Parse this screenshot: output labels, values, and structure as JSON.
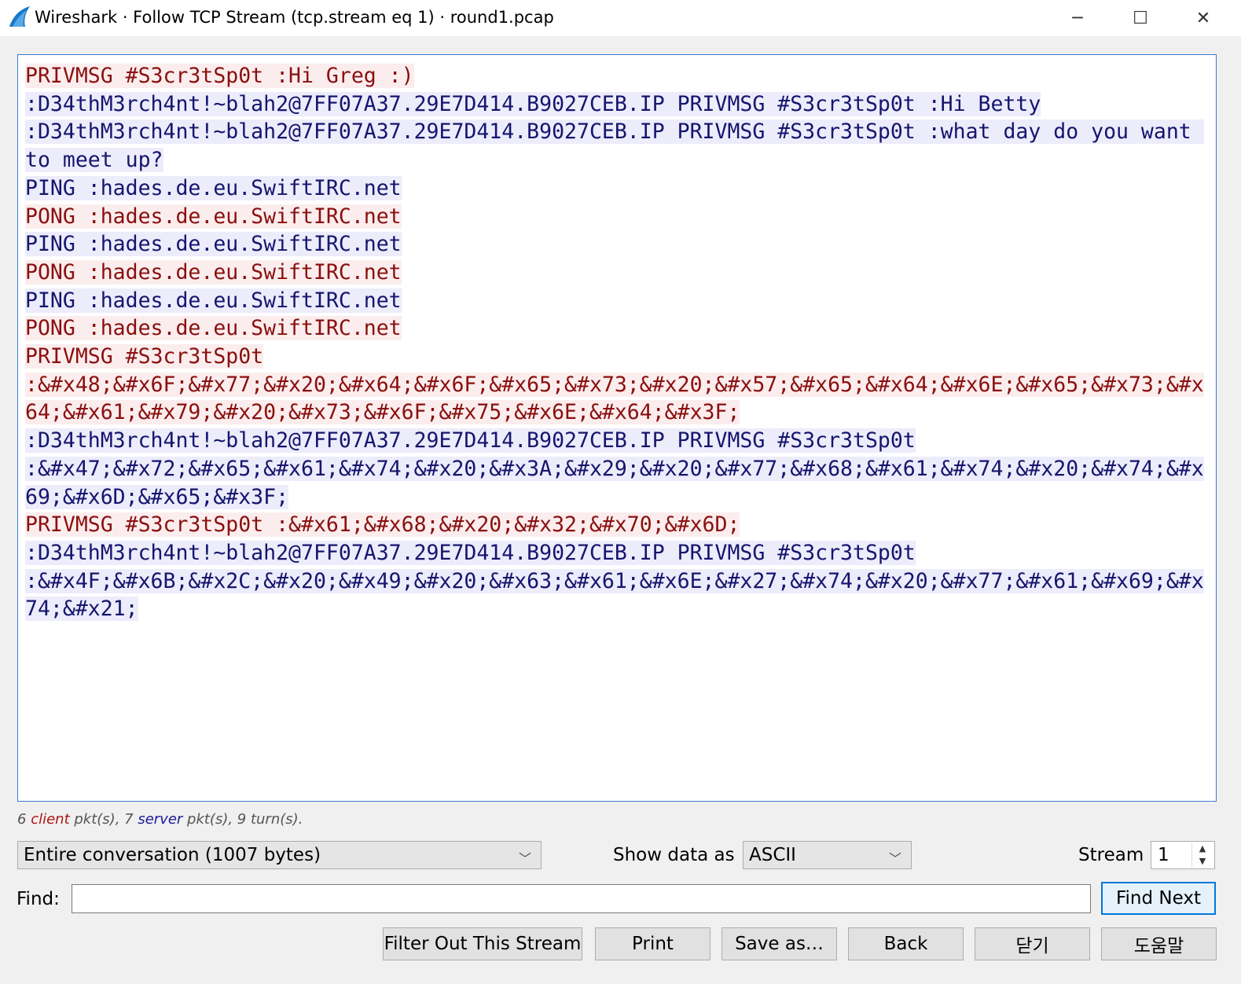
{
  "window": {
    "title": "Wireshark · Follow TCP Stream (tcp.stream eq 1) · round1.pcap",
    "minimize_glyph": "─",
    "maximize_glyph": "☐",
    "close_glyph": "✕"
  },
  "stream_segments": [
    {
      "dir": "client",
      "text": "PRIVMSG #S3cr3tSp0t :Hi Greg :)"
    },
    {
      "dir": "server",
      "text": ":D34thM3rch4nt!~blah2@7FF07A37.29E7D414.B9027CEB.IP PRIVMSG #S3cr3tSp0t :Hi Betty"
    },
    {
      "dir": "server",
      "text": ":D34thM3rch4nt!~blah2@7FF07A37.29E7D414.B9027CEB.IP PRIVMSG #S3cr3tSp0t :what day do you want to meet up?"
    },
    {
      "dir": "server",
      "text": "PING :hades.de.eu.SwiftIRC.net"
    },
    {
      "dir": "client",
      "text": "PONG :hades.de.eu.SwiftIRC.net"
    },
    {
      "dir": "server",
      "text": "PING :hades.de.eu.SwiftIRC.net"
    },
    {
      "dir": "client",
      "text": "PONG :hades.de.eu.SwiftIRC.net"
    },
    {
      "dir": "server",
      "text": "PING :hades.de.eu.SwiftIRC.net"
    },
    {
      "dir": "client",
      "text": "PONG :hades.de.eu.SwiftIRC.net"
    },
    {
      "dir": "client",
      "text": "PRIVMSG #S3cr3tSp0t\n:&#x48;&#x6F;&#x77;&#x20;&#x64;&#x6F;&#x65;&#x73;&#x20;&#x57;&#x65;&#x64;&#x6E;&#x65;&#x73;&#x64;&#x61;&#x79;&#x20;&#x73;&#x6F;&#x75;&#x6E;&#x64;&#x3F;"
    },
    {
      "dir": "server",
      "text": ":D34thM3rch4nt!~blah2@7FF07A37.29E7D414.B9027CEB.IP PRIVMSG #S3cr3tSp0t\n:&#x47;&#x72;&#x65;&#x61;&#x74;&#x20;&#x3A;&#x29;&#x20;&#x77;&#x68;&#x61;&#x74;&#x20;&#x74;&#x69;&#x6D;&#x65;&#x3F;"
    },
    {
      "dir": "client",
      "text": "PRIVMSG #S3cr3tSp0t :&#x61;&#x68;&#x20;&#x32;&#x70;&#x6D;"
    },
    {
      "dir": "server",
      "text": ":D34thM3rch4nt!~blah2@7FF07A37.29E7D414.B9027CEB.IP PRIVMSG #S3cr3tSp0t\n:&#x4F;&#x6B;&#x2C;&#x20;&#x49;&#x20;&#x63;&#x61;&#x6E;&#x27;&#x74;&#x20;&#x77;&#x61;&#x69;&#x74;&#x21;"
    }
  ],
  "stats": {
    "client_count": "6",
    "client_word": "client",
    "mid": " pkt(s), 7 ",
    "server_word": "server",
    "tail": " pkt(s), 9 turn(s)."
  },
  "conversation_select": "Entire conversation (1007 bytes)",
  "show_data_label": "Show data as",
  "show_data_select": "ASCII",
  "stream_label": "Stream",
  "stream_value": "1",
  "find_label": "Find:",
  "find_value": "",
  "buttons": {
    "find_next": "Find Next",
    "filter_out": "Filter Out This Stream",
    "print": "Print",
    "save_as": "Save as…",
    "back": "Back",
    "close": "닫기",
    "help": "도움말"
  },
  "colors": {
    "client_fg": "#8a0f0f",
    "client_bg": "#fbeded",
    "server_fg": "#15156e",
    "server_bg": "#ececfb",
    "accent": "#0078d7"
  }
}
